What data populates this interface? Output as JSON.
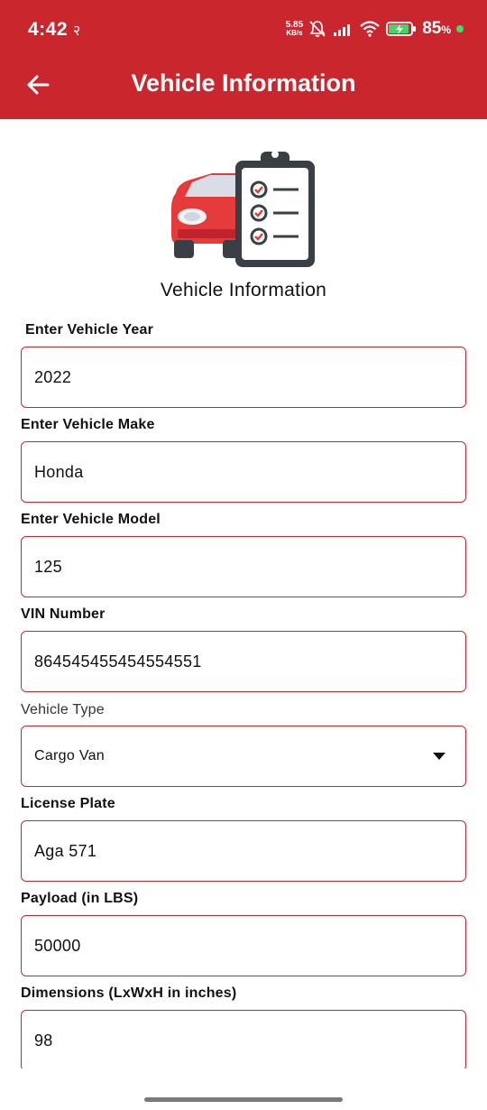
{
  "status_bar": {
    "time": "4:42",
    "time_icon": "२",
    "net_speed_value": "5.85",
    "net_speed_unit": "KB/s",
    "battery_percent": "85",
    "battery_percent_suffix": "%"
  },
  "app_bar": {
    "title": "Vehicle Information",
    "back_icon": "arrow-left-icon"
  },
  "hero": {
    "icon": "car-checklist-icon",
    "caption": "Vehicle Information"
  },
  "fields": {
    "year": {
      "label": "Enter Vehicle Year",
      "value": "2022"
    },
    "make": {
      "label": "Enter Vehicle  Make",
      "value": "Honda"
    },
    "model": {
      "label": "Enter Vehicle  Model",
      "value": "125"
    },
    "vin": {
      "label": "VIN Number",
      "value": "864545455454554551"
    },
    "vehicle_type": {
      "label": "Vehicle Type",
      "value": "Cargo Van"
    },
    "license_plate": {
      "label": "License Plate",
      "value": "Aga 571"
    },
    "payload": {
      "label": "Payload (in LBS)",
      "value": "50000"
    },
    "dimensions": {
      "label": "Dimensions (LxWxH in inches)",
      "value": "98"
    }
  },
  "colors": {
    "brand": "#c9262d",
    "border": "#c9262d",
    "background": "#ffffff"
  }
}
